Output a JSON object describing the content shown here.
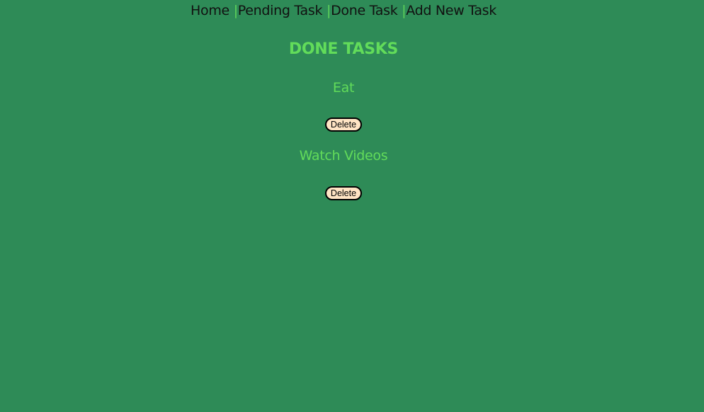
{
  "nav": {
    "items": [
      "Home",
      "Pending Task",
      "Done Task",
      "Add New Task"
    ],
    "separator": "|"
  },
  "heading": "DONE TASKS",
  "tasks": [
    {
      "title": "Eat",
      "delete_label": "Delete"
    },
    {
      "title": "Watch Videos",
      "delete_label": "Delete"
    }
  ]
}
